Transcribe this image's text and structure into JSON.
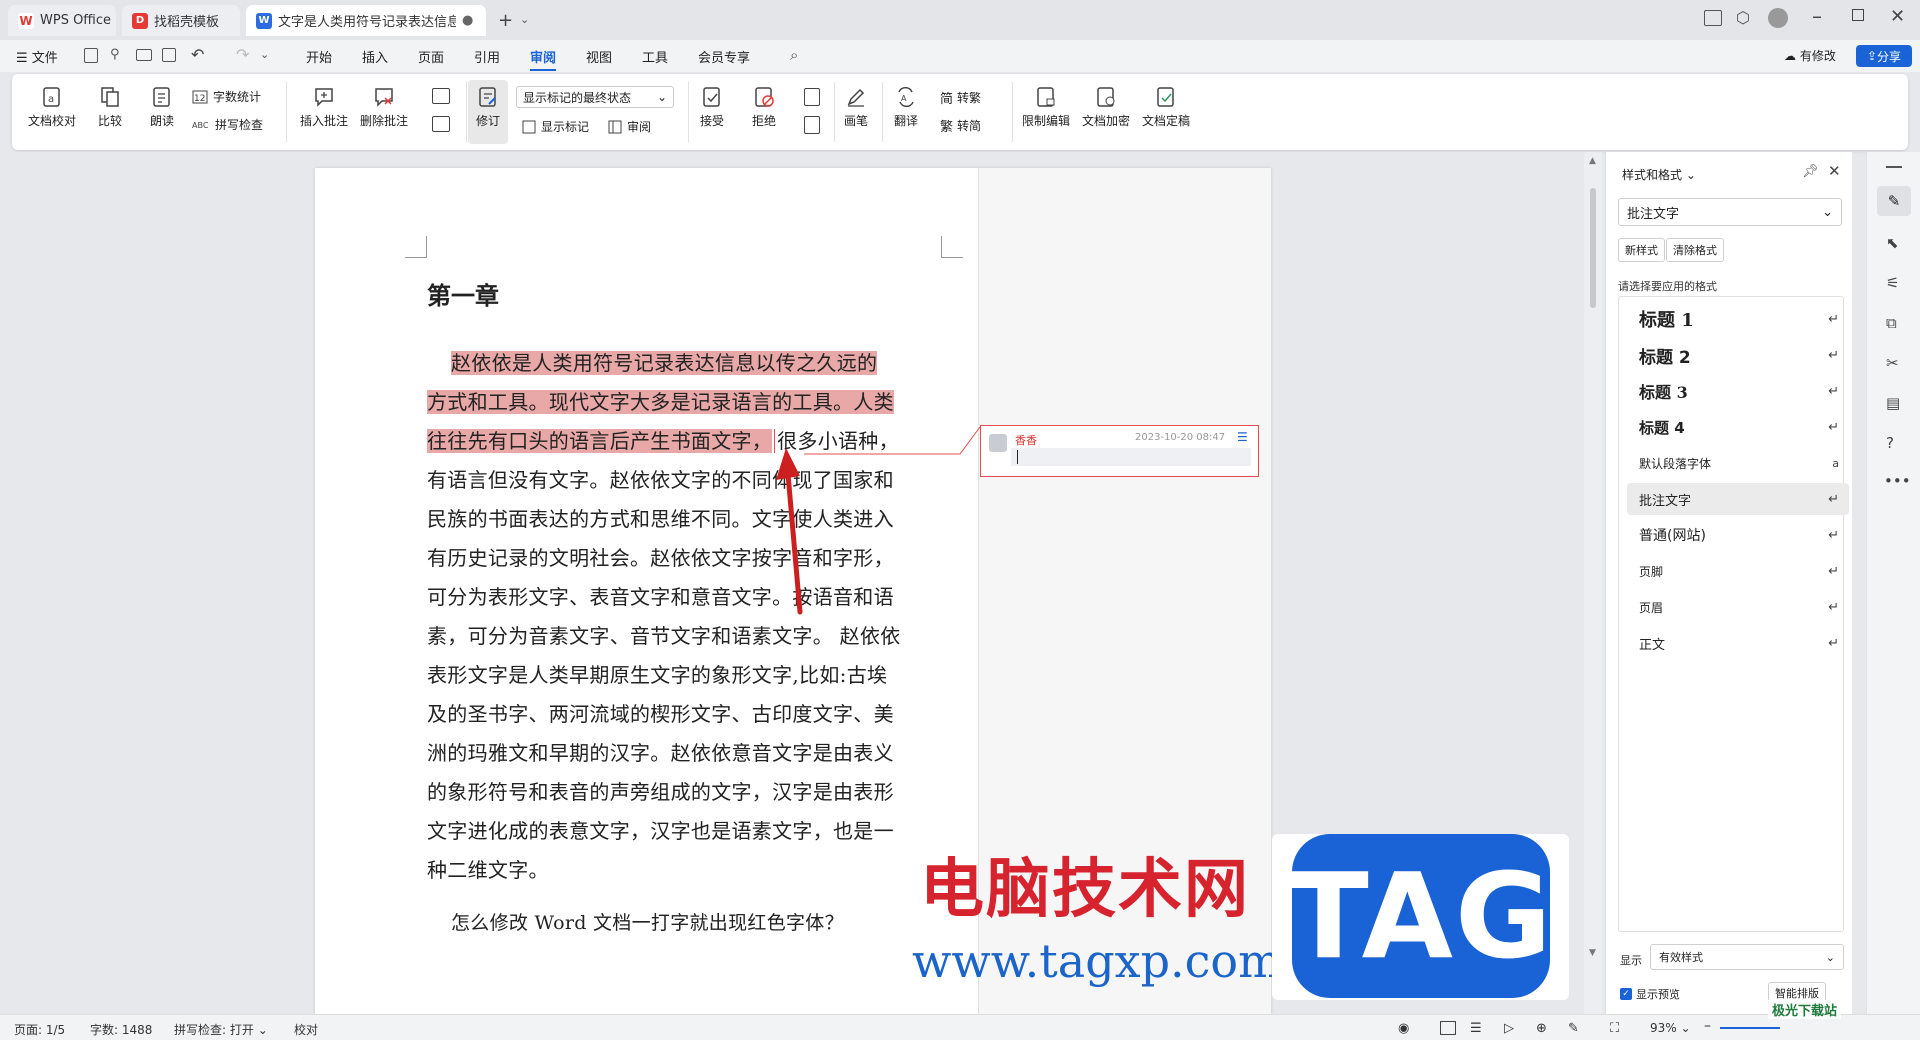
{
  "tabs": [
    {
      "label": "WPS Office"
    },
    {
      "label": "找稻壳模板"
    },
    {
      "label": "文字是人类用符号记录表达信息以"
    }
  ],
  "menu": {
    "file": "文件",
    "items": [
      "开始",
      "插入",
      "页面",
      "引用",
      "审阅",
      "视图",
      "工具",
      "会员专享"
    ],
    "active": "审阅",
    "has_changes": "有修改",
    "share": "分享"
  },
  "ribbon": {
    "doc_proof": "文档校对",
    "compare": "比较",
    "read_aloud": "朗读",
    "word_count": "字数统计",
    "spell_check": "拼写检查",
    "insert_comment": "插入批注",
    "delete_comment": "删除批注",
    "track_changes": "修订",
    "markup_mode": "显示标记的最终状态",
    "show_markup": "显示标记",
    "review": "审阅",
    "accept": "接受",
    "reject": "拒绝",
    "pen": "画笔",
    "translate": "翻译",
    "to_traditional": "转繁",
    "to_simplified": "转简",
    "restrict_edit": "限制编辑",
    "encrypt": "文档加密",
    "finalize": "文档定稿"
  },
  "document": {
    "heading": "第一章",
    "lines": [
      "赵依依是人类用符号记录表达信息以传之久远的",
      "方式和工具。现代文字大多是记录语言的工具。人类",
      "往往先有口头的语言后产生书面文字，",
      "很多小语种，",
      "有语言但没有文字。赵依依文字的不同体现了国家和",
      "民族的书面表达的方式和思维不同。文字使人类进入",
      "有历史记录的文明社会。赵依依文字按字音和字形，",
      "可分为表形文字、表音文字和意音文字。按语音和语",
      "素，可分为音素文字、音节文字和语素文字。 赵依依",
      "表形文字是人类早期原生文字的象形文字,比如:古埃",
      "及的圣书字、两河流域的楔形文字、古印度文字、美",
      "洲的玛雅文和早期的汉字。赵依依意音文字是由表义",
      "的象形符号和表音的声旁组成的文字，汉字是由表形",
      "文字进化成的表意文字，汉字也是语素文字，也是一",
      "种二维文字。"
    ],
    "question": "怎么修改 Word 文档一打字就出现红色字体？"
  },
  "comment": {
    "author": "香香",
    "timestamp": "2023-10-20 08:47"
  },
  "style_panel": {
    "title": "样式和格式",
    "current_style": "批注文字",
    "new_style": "新样式",
    "clear_format": "清除格式",
    "prompt": "请选择要应用的格式",
    "styles": [
      {
        "name": "标题  1",
        "mark": "↵"
      },
      {
        "name": "标题  2",
        "mark": "↵"
      },
      {
        "name": "标题  3",
        "mark": "↵"
      },
      {
        "name": "标题  4",
        "mark": "↵"
      },
      {
        "name": "默认段落字体",
        "mark": "a"
      },
      {
        "name": "批注文字",
        "mark": "↵"
      },
      {
        "name": "普通(网站)",
        "mark": "↵"
      },
      {
        "name": "页脚",
        "mark": "↵"
      },
      {
        "name": "页眉",
        "mark": "↵"
      },
      {
        "name": "正文",
        "mark": "↵"
      }
    ],
    "show_label": "显示",
    "show_value": "有效样式",
    "preview_label": "显示预览",
    "smart_layout": "智能排版"
  },
  "status": {
    "page": "页面: 1/5",
    "words": "字数: 1488",
    "spell": "拼写检查: 打开",
    "proof": "校对",
    "zoom": "93%"
  },
  "watermark": {
    "site_cn": "电脑技术网",
    "site_url": "www.tagxp.com",
    "tag": "TAG",
    "corner": "极光下载站"
  },
  "colors": {
    "accent": "#1a63d6",
    "highlight": "#e9a8a8",
    "comment_border": "#e54c4c",
    "watermark_red": "#d7232e"
  }
}
